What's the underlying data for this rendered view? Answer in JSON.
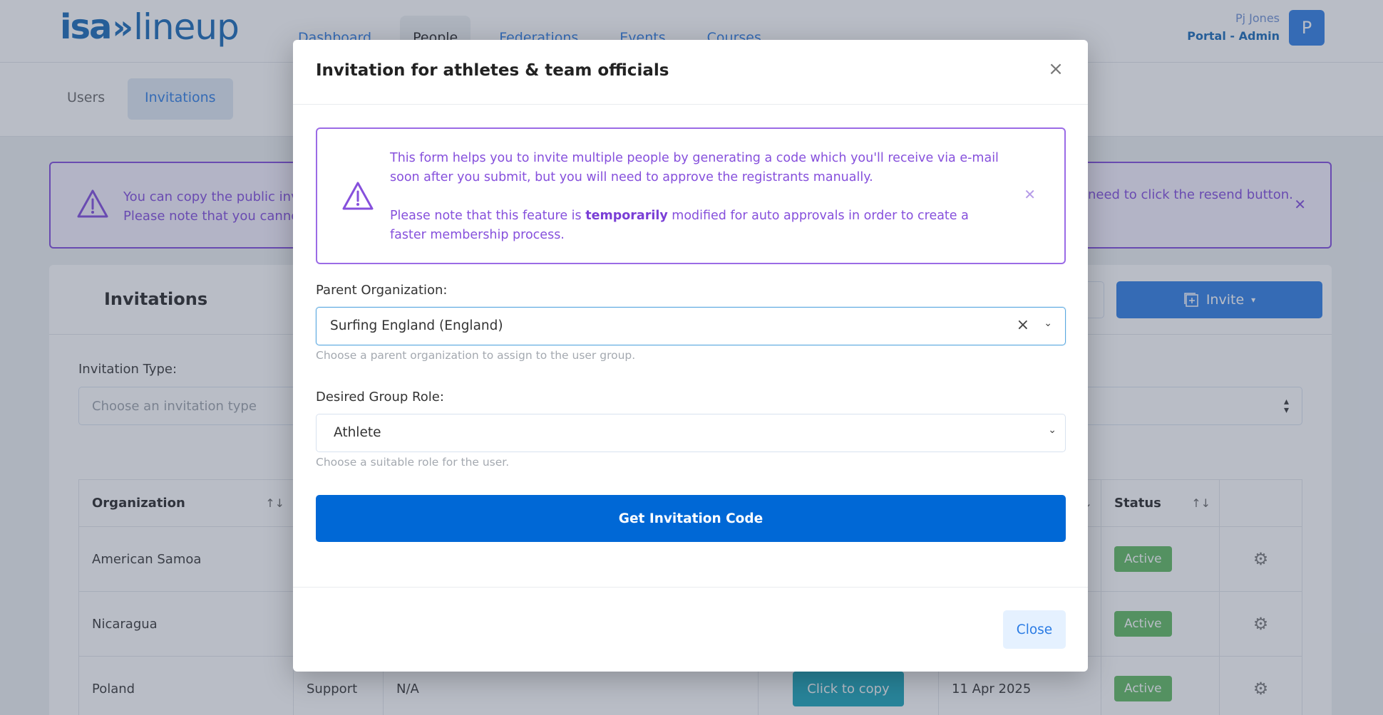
{
  "app": {
    "logo_part1": "isa",
    "logo_part2": "»",
    "logo_part3": "lineup",
    "nav": [
      "Dashboard",
      "People",
      "Federations",
      "Events",
      "Courses"
    ],
    "active_nav": "People",
    "user_name": "Pj Jones",
    "user_role": "Portal - Admin",
    "avatar_letter": "P"
  },
  "subnav": {
    "items": [
      "Users",
      "Invitations"
    ],
    "active": "Invitations"
  },
  "background_alert": {
    "line1": "You can copy the public invita",
    "line2": "Please note that you cannot",
    "line_right": "need to click the resend button."
  },
  "card": {
    "title": "Invitations",
    "invite_button": "Invite",
    "filter_label": "Invitation Type:",
    "filter_placeholder": "Choose an invitation type"
  },
  "table": {
    "headers": [
      "Organization",
      "",
      "",
      "",
      "",
      "Status",
      ""
    ],
    "rows": [
      {
        "organization": "American Samoa",
        "status": "Active"
      },
      {
        "organization": "Nicaragua",
        "status": "Active"
      },
      {
        "organization": "Poland",
        "type": "Support",
        "role": "N/A",
        "copy": "Click to copy",
        "date": "11 Apr 2025",
        "status": "Active"
      }
    ]
  },
  "modal": {
    "title": "Invitation for athletes & team officials",
    "info": {
      "p1": "This form helps you to invite multiple people by generating a code which you'll receive via e-mail soon after you submit, but you will need to approve the registrants manually.",
      "p2_before": "Please note that this feature is ",
      "p2_bold": "temporarily",
      "p2_after": " modified for auto approvals in order to create a faster membership process."
    },
    "parent_org": {
      "label": "Parent Organization:",
      "value": "Surfing England (England)",
      "help": "Choose a parent organization to assign to the user group."
    },
    "group_role": {
      "label": "Desired Group Role:",
      "value": "Athlete",
      "help": "Choose a suitable role for the user."
    },
    "submit_button": "Get Invitation Code",
    "close_button": "Close"
  },
  "colors": {
    "primary": "#0068d6",
    "accent_blue": "#2a7be4",
    "info_purple": "#8650dc",
    "success": "#5cb85c",
    "teal": "#16a3b8"
  }
}
